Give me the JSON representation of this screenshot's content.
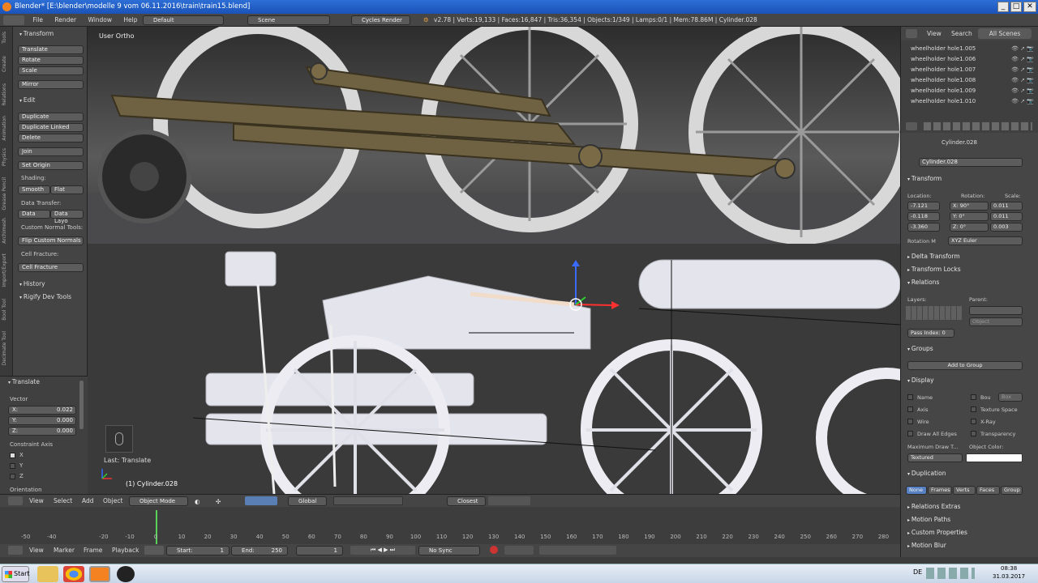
{
  "window": {
    "title": "Blender* [E:\\blender\\modelle 9 vom 06.11.2016\\train\\train15.blend]"
  },
  "infobar": {
    "menus": [
      "File",
      "Render",
      "Window",
      "Help"
    ],
    "layout": "Default",
    "scene": "Scene",
    "engine": "Cycles Render",
    "stats": "v2.78 | Verts:19,133 | Faces:16,847 | Tris:36,354 | Objects:1/349 | Lamps:0/1 | Mem:78.86M | Cylinder.028"
  },
  "toolshelf": {
    "tabs": [
      "Tools",
      "Create",
      "Relations",
      "Animation",
      "Physics",
      "Grease Pencil",
      "Archimesh",
      "Import/Export",
      "Bool Tool",
      "Decimate Tool"
    ],
    "transform_header": "Transform",
    "transform_buttons": [
      "Translate",
      "Rotate",
      "Scale"
    ],
    "mirror": "Mirror",
    "edit_header": "Edit",
    "edit_buttons": [
      "Duplicate",
      "Duplicate Linked",
      "Delete"
    ],
    "join": "Join",
    "set_origin": "Set Origin",
    "shading_label": "Shading:",
    "smooth": "Smooth",
    "flat": "Flat",
    "data_transfer_label": "Data Transfer:",
    "data": "Data",
    "data_layout": "Data Layo",
    "custom_normal_label": "Custom Normal Tools:",
    "flip_normals": "Flip Custom Normals",
    "cell_fracture_label": "Cell Fracture:",
    "cell_fracture": "Cell Fracture",
    "history": "History",
    "rigify": "Rigify Dev Tools",
    "operator_header": "Translate",
    "vector_label": "Vector",
    "x": "X:",
    "x_val": "0.022",
    "y": "Y:",
    "y_val": "0.000",
    "z": "Z:",
    "z_val": "0.000",
    "constraint_label": "Constraint Axis",
    "cx": "X",
    "cy": "Y",
    "cz": "Z",
    "orientation_label": "Orientation"
  },
  "viewport": {
    "view_label": "User Ortho",
    "last_op": "Last: Translate",
    "object_label": "(1) Cylinder.028"
  },
  "viewport_header": {
    "menus": [
      "View",
      "Select",
      "Add",
      "Object"
    ],
    "mode": "Object Mode",
    "orientation": "Global",
    "snap": "Closest"
  },
  "timeline": {
    "ticks": [
      "-50",
      "-40",
      "-20",
      "-10",
      "0",
      "10",
      "20",
      "30",
      "40",
      "50",
      "60",
      "70",
      "80",
      "90",
      "100",
      "110",
      "120",
      "130",
      "140",
      "150",
      "160",
      "170",
      "180",
      "190",
      "200",
      "210",
      "220",
      "230",
      "240",
      "250",
      "260",
      "270",
      "280"
    ],
    "menus": [
      "View",
      "Marker",
      "Frame",
      "Playback"
    ],
    "start_label": "Start:",
    "start": "1",
    "end_label": "End:",
    "end": "250",
    "current": "1",
    "sync": "No Sync"
  },
  "outliner": {
    "menus": [
      "View",
      "Search"
    ],
    "filter": "All Scenes",
    "items": [
      "wheelholder hole1.005",
      "wheelholder hole1.006",
      "wheelholder hole1.007",
      "wheelholder hole1.008",
      "wheelholder hole1.009",
      "wheelholder hole1.010"
    ]
  },
  "properties": {
    "breadcrumb": "Cylinder.028",
    "object_name": "Cylinder.028",
    "transform": "Transform",
    "location_label": "Location:",
    "rotation_label": "Rotation:",
    "scale_label": "Scale:",
    "loc": [
      "-7.121",
      "-0.118",
      "-3.360"
    ],
    "rot": [
      "X: 90°",
      "Y: 0°",
      "Z: 0°"
    ],
    "scale": [
      "0.011",
      "0.011",
      "0.003"
    ],
    "rotation_mode_label": "Rotation M",
    "rotation_mode": "XYZ Euler",
    "delta_transform": "Delta Transform",
    "transform_locks": "Transform Locks",
    "relations": "Relations",
    "layers_label": "Layers:",
    "parent_label": "Parent:",
    "parent_type": "Object",
    "pass_index": "Pass Index:",
    "pass_index_val": "0",
    "groups": "Groups",
    "add_to_group": "Add to Group",
    "display": "Display",
    "name": "Name",
    "bounds": "Bou",
    "box": "Box",
    "axis": "Axis",
    "texture_space": "Texture Space",
    "wire": "Wire",
    "xray": "X-Ray",
    "draw_all_edges": "Draw All Edges",
    "transparency": "Transparency",
    "max_draw_label": "Maximum Draw T...",
    "object_color_label": "Object Color:",
    "max_draw": "Textured",
    "duplication": "Duplication",
    "dup_options": [
      "None",
      "Frames",
      "Verts",
      "Faces",
      "Group"
    ],
    "relations_extras": "Relations Extras",
    "motion_paths": "Motion Paths",
    "custom_props": "Custom Properties",
    "motion_blur": "Motion Blur"
  },
  "taskbar": {
    "start": "Start",
    "lang": "DE",
    "time": "08:38",
    "date": "31.03.2017"
  }
}
